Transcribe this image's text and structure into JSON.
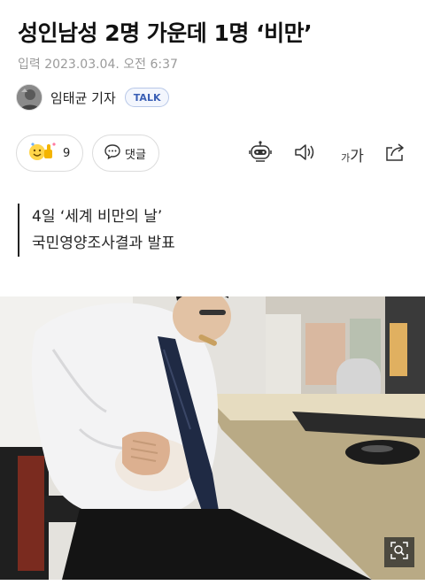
{
  "article": {
    "headline": "성인남성 2명 가운데 1명 ‘비만’",
    "dateline": "입력 2023.03.04. 오전 6:37",
    "author": "임태균 기자",
    "talk_badge": "TALK"
  },
  "actions": {
    "reaction_count": "9",
    "comment_label": "댓글",
    "font_size_label_small": "가",
    "font_size_label_large": "가"
  },
  "summary": {
    "lines": [
      "4일 ‘세계 비만의 날’",
      "국민영양조사결과 발표"
    ]
  },
  "icons": {
    "reaction": "emoji-reaction-icon",
    "comment": "speech-bubble-icon",
    "robot": "robot-summary-icon",
    "speaker": "speaker-icon",
    "font": "font-size-icon",
    "share": "share-icon",
    "zoom": "zoom-search-icon"
  },
  "colors": {
    "talk_badge_text": "#3a5fb5",
    "talk_badge_border": "#b8c8e8",
    "meta_gray": "#9a9a9a"
  }
}
